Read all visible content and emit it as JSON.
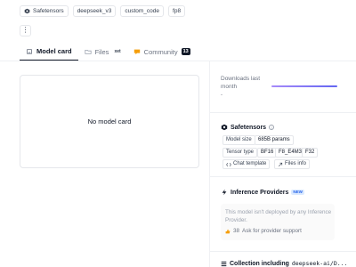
{
  "tags": [
    {
      "label": "Safetensors",
      "icon": "safetensors-icon"
    },
    {
      "label": "deepseek_v3"
    },
    {
      "label": "custom_code"
    },
    {
      "label": "fp8"
    }
  ],
  "menu": {
    "kebab": "⋮"
  },
  "tabs": [
    {
      "label": "Model card",
      "active": true
    },
    {
      "label": "Files",
      "badge": "xet"
    },
    {
      "label": "Community",
      "count": "13"
    }
  ],
  "model_card": {
    "empty_text": "No model card"
  },
  "downloads": {
    "label": "Downloads last month",
    "value": "-"
  },
  "safetensors": {
    "title": "Safetensors",
    "model_size_label": "Model size",
    "model_size_value": "685B params",
    "tensor_type_label": "Tensor type",
    "tensor_types": [
      "BF16",
      "F8_E4M3",
      "F32"
    ],
    "chat_template_label": "Chat template",
    "files_info_label": "Files info"
  },
  "inference": {
    "title": "Inference Providers",
    "badge": "NEW",
    "message": "This model isn't deployed by any Inference Provider.",
    "support_count": "38",
    "support_label": "Ask for provider support"
  },
  "collection": {
    "label": "Collection including",
    "name": "deepseek-ai/D..."
  },
  "colors": {
    "accent": "#6366f1",
    "badge_bg": "#dbeafe"
  }
}
